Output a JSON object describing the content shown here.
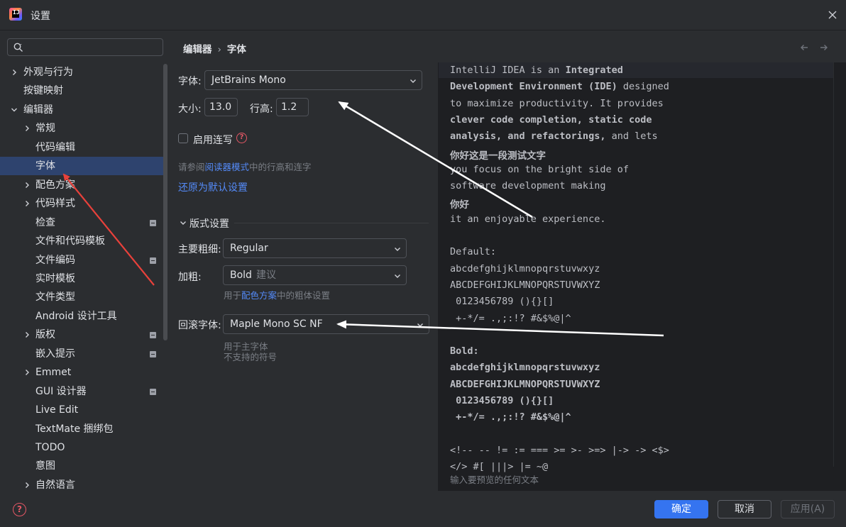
{
  "window": {
    "title": "设置",
    "logo_mark": "IJ"
  },
  "search": {
    "placeholder": "",
    "value": ""
  },
  "breadcrumb": {
    "parent": "编辑器",
    "separator": "›",
    "current": "字体"
  },
  "sidebar": {
    "items": [
      {
        "label": "外观与行为",
        "indent": 0,
        "chevron": "right",
        "badge": false
      },
      {
        "label": "按键映射",
        "indent": 0,
        "chevron": "none",
        "badge": false
      },
      {
        "label": "编辑器",
        "indent": 0,
        "chevron": "down",
        "badge": false
      },
      {
        "label": "常规",
        "indent": 1,
        "chevron": "right",
        "badge": false
      },
      {
        "label": "代码编辑",
        "indent": 1,
        "chevron": "none",
        "badge": false
      },
      {
        "label": "字体",
        "indent": 1,
        "chevron": "none",
        "badge": false,
        "selected": true
      },
      {
        "label": "配色方案",
        "indent": 1,
        "chevron": "right",
        "badge": false
      },
      {
        "label": "代码样式",
        "indent": 1,
        "chevron": "right",
        "badge": false
      },
      {
        "label": "检查",
        "indent": 1,
        "chevron": "none",
        "badge": true
      },
      {
        "label": "文件和代码模板",
        "indent": 1,
        "chevron": "none",
        "badge": false
      },
      {
        "label": "文件编码",
        "indent": 1,
        "chevron": "none",
        "badge": true
      },
      {
        "label": "实时模板",
        "indent": 1,
        "chevron": "none",
        "badge": false
      },
      {
        "label": "文件类型",
        "indent": 1,
        "chevron": "none",
        "badge": false
      },
      {
        "label": "Android 设计工具",
        "indent": 1,
        "chevron": "none",
        "badge": false
      },
      {
        "label": "版权",
        "indent": 1,
        "chevron": "right",
        "badge": true
      },
      {
        "label": "嵌入提示",
        "indent": 1,
        "chevron": "none",
        "badge": true
      },
      {
        "label": "Emmet",
        "indent": 1,
        "chevron": "right",
        "badge": false
      },
      {
        "label": "GUI 设计器",
        "indent": 1,
        "chevron": "none",
        "badge": true
      },
      {
        "label": "Live Edit",
        "indent": 1,
        "chevron": "none",
        "badge": false
      },
      {
        "label": "TextMate 捆绑包",
        "indent": 1,
        "chevron": "none",
        "badge": false
      },
      {
        "label": "TODO",
        "indent": 1,
        "chevron": "none",
        "badge": false
      },
      {
        "label": "意图",
        "indent": 1,
        "chevron": "none",
        "badge": false
      },
      {
        "label": "自然语言",
        "indent": 1,
        "chevron": "right",
        "badge": false
      }
    ]
  },
  "font": {
    "font_label": "字体:",
    "font_value": "JetBrains Mono",
    "size_label": "大小:",
    "size_value": "13.0",
    "line_height_label": "行高:",
    "line_height_value": "1.2",
    "ligatures_label": "启用连写",
    "ligatures_checked": false,
    "reader_hint_prefix": "请参阅",
    "reader_hint_link": "阅读器模式",
    "reader_hint_suffix": "中的行高和连字",
    "reset_link": "还原为默认设置"
  },
  "typography": {
    "section_title": "版式设置",
    "main_weight_label": "主要粗细:",
    "main_weight_value": "Regular",
    "bold_label": "加粗:",
    "bold_value": "Bold",
    "bold_hint": "建议",
    "bold_note_prefix": "用于",
    "bold_note_link": "配色方案",
    "bold_note_suffix": "中的粗体设置",
    "fallback_label": "回滚字体:",
    "fallback_value": "Maple Mono SC NF",
    "fallback_note_1": "用于主字体",
    "fallback_note_2": "不支持的符号"
  },
  "preview": {
    "lines": [
      {
        "text": "IntelliJ IDEA is an ",
        "bold_tail": "Integrated",
        "bold": false
      },
      {
        "text": "Development Environment (IDE)",
        "tail": " designed",
        "bold": true
      },
      {
        "text": "to maximize productivity. It provides",
        "bold": false
      },
      {
        "text": "clever code completion, static code",
        "bold": true
      },
      {
        "text": "analysis, and refactorings,",
        "tail": " and lets",
        "bold": true
      },
      {
        "text": "你好这是一段测试文字",
        "bold": true
      },
      {
        "text": "you focus on the bright side of",
        "bold": false
      },
      {
        "text": "software development making",
        "bold": false
      },
      {
        "text": "你好",
        "bold": true
      },
      {
        "text": "it an enjoyable experience.",
        "bold": false
      },
      {
        "text": "",
        "bold": false
      },
      {
        "text": "Default:",
        "bold": false
      },
      {
        "text": "abcdefghijklmnopqrstuvwxyz",
        "bold": false
      },
      {
        "text": "ABCDEFGHIJKLMNOPQRSTUVWXYZ",
        "bold": false
      },
      {
        "text": " 0123456789 (){}[]",
        "bold": false
      },
      {
        "text": " +-*/= .,;:!? #&$%@|^",
        "bold": false
      },
      {
        "text": "",
        "bold": false
      },
      {
        "text": "Bold:",
        "bold": true
      },
      {
        "text": "abcdefghijklmnopqrstuvwxyz",
        "bold": true
      },
      {
        "text": "ABCDEFGHIJKLMNOPQRSTUVWXYZ",
        "bold": true
      },
      {
        "text": " 0123456789 (){}[]",
        "bold": true
      },
      {
        "text": " +-*/= .,;:!? #&$%@|^",
        "bold": true
      },
      {
        "text": "",
        "bold": false
      },
      {
        "text": "<!-- -- != := === >= >- >=> |-> -> <$>",
        "bold": false
      },
      {
        "text": "</> #[ |||> |= ~@",
        "bold": false
      }
    ],
    "hint": "输入要预览的任何文本"
  },
  "footer": {
    "ok": "确定",
    "cancel": "取消",
    "apply": "应用(A)"
  },
  "colors": {
    "accent": "#3574f0",
    "link": "#548af7",
    "selection": "#2e436e",
    "error": "#e55765",
    "arrow_red": "#e8413b",
    "arrow_white": "#ffffff"
  }
}
